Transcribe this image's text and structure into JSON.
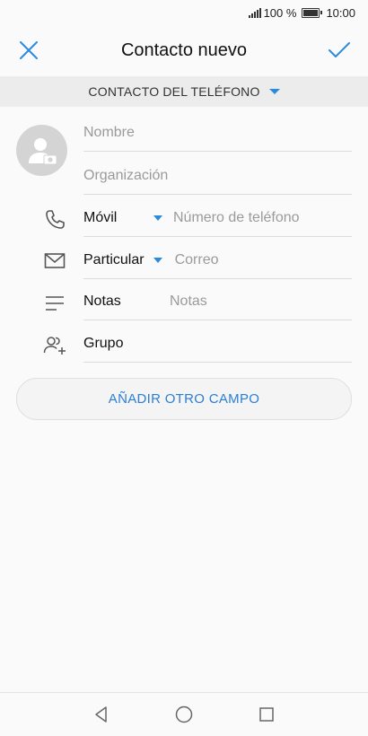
{
  "status_bar": {
    "battery_percent": "100 %",
    "time": "10:00"
  },
  "header": {
    "title": "Contacto nuevo",
    "cancel_icon": "close-icon",
    "confirm_icon": "check-icon",
    "accent_color": "#2a8ae0"
  },
  "account": {
    "label": "CONTACTO DEL TELÉFONO"
  },
  "form": {
    "name_placeholder": "Nombre",
    "organization_placeholder": "Organización",
    "phone": {
      "type_label": "Móvil",
      "placeholder": "Número de teléfono"
    },
    "email": {
      "type_label": "Particular",
      "placeholder": "Correo"
    },
    "notes": {
      "label": "Notas",
      "placeholder": "Notas"
    },
    "group": {
      "label": "Grupo"
    }
  },
  "add_field_button": "AÑADIR OTRO CAMPO",
  "nav": {
    "back": "back-icon",
    "home": "home-icon",
    "recents": "recents-icon"
  }
}
